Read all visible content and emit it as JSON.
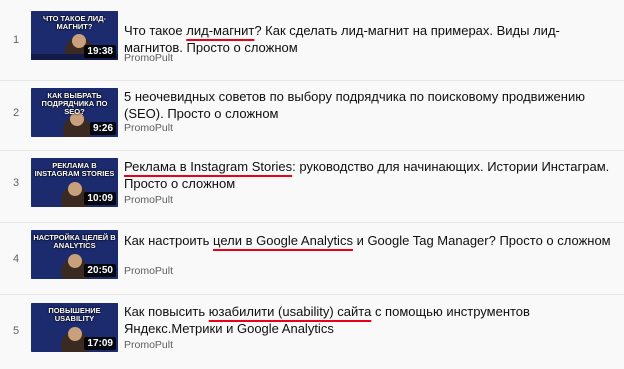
{
  "playlist": {
    "items": [
      {
        "index": "1",
        "thumb_caption": "ЧТО ТАКОЕ ЛИД-МАГНИТ?",
        "duration": "19:38",
        "title_parts": [
          "Что такое ",
          "лид-магнит",
          "? Как сделать лид-магнит на примерах. Виды лид-магнитов. Просто о сложном"
        ],
        "channel": "PromoPult"
      },
      {
        "index": "2",
        "thumb_caption": "КАК ВЫБРАТЬ ПОДРЯДЧИКА ПО SEO?",
        "duration": "9:26",
        "title_parts": [
          "5 неочевидных советов по выбору подрядчика по поисковому продвижению (SEO). Просто о сложном",
          "",
          ""
        ],
        "channel": "PromoPult"
      },
      {
        "index": "3",
        "thumb_caption": "РЕКЛАМА В INSTAGRAM STORIES",
        "duration": "10:09",
        "title_parts": [
          "",
          "Реклама в Instagram Stories",
          ": руководство для начинающих. Истории Инстаграм. Просто о сложном"
        ],
        "channel": "PromoPult"
      },
      {
        "index": "4",
        "thumb_caption": "НАСТРОЙКА ЦЕЛЕЙ В ANALYTICS",
        "duration": "20:50",
        "title_parts": [
          "Как настроить ",
          "цели в Google Analytics",
          " и Google Tag Manager? Просто о сложном"
        ],
        "channel": "PromoPult"
      },
      {
        "index": "5",
        "thumb_caption": "ПОВЫШЕНИЕ USABILITY",
        "duration": "17:09",
        "title_parts": [
          "Как повысить ",
          "юзабилити (usability) сайта",
          " с помощью инструментов Яндекс.Метрики и Google Analytics"
        ],
        "channel": "PromoPult"
      }
    ]
  },
  "colors": {
    "underline": "#e8001c",
    "thumb_bg": "#1c2a6e",
    "thumb_accent": "#f4b400"
  }
}
